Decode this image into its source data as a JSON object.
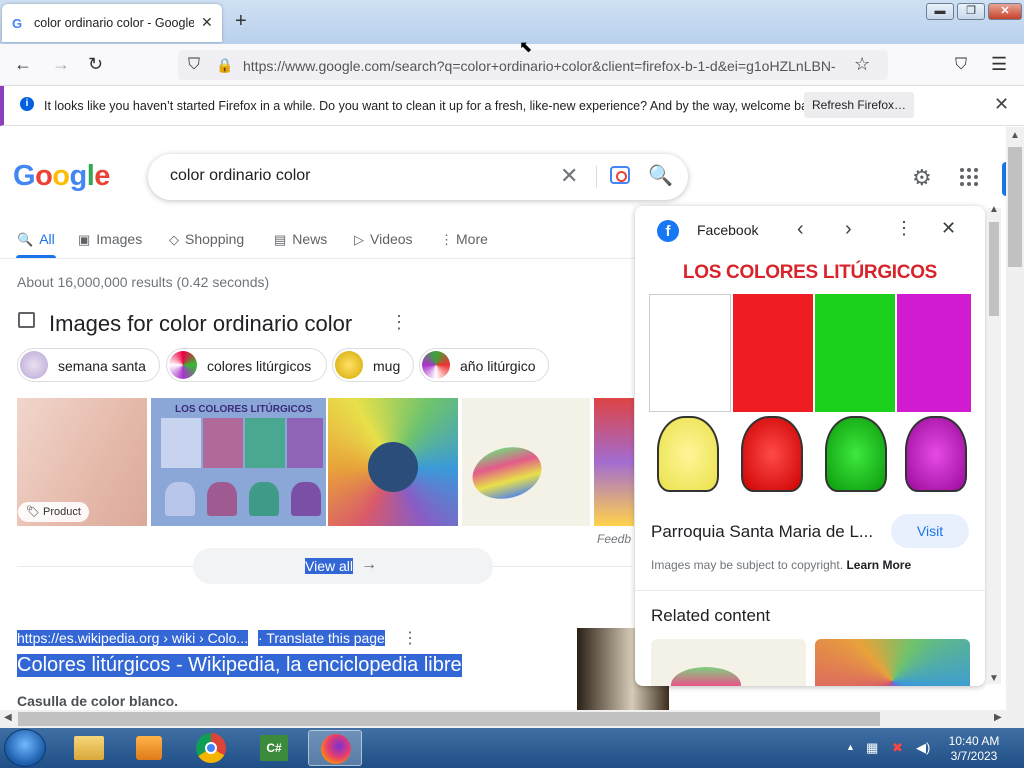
{
  "browser": {
    "tab_title": "color ordinario color - Google S",
    "tab_favicon": "G",
    "close_tab": "✕",
    "new_tab": "+",
    "url": "https://www.google.com/search?q=color+ordinario+color&client=firefox-b-1-d&ei=g1oHZLnLBN-",
    "window_controls": {
      "minimize": "▬",
      "maximize": "❐",
      "close": "✕"
    },
    "nav": {
      "back": "←",
      "forward": "→",
      "reload": "↻",
      "shield": "⛉",
      "lock": "🔒",
      "star": "☆",
      "pocket": "⛉",
      "menu": "☰"
    }
  },
  "notification": {
    "icon": "i",
    "message": "It looks like you haven’t started Firefox in a while. Do you want to clean it up for a fresh, like-new experience? And by the way, welcome back!",
    "button": "Refresh Firefox…",
    "close": "✕"
  },
  "google": {
    "logo_letters": [
      {
        "ch": "G",
        "color": "#4285f4"
      },
      {
        "ch": "o",
        "color": "#ea4335"
      },
      {
        "ch": "o",
        "color": "#fbbc05"
      },
      {
        "ch": "g",
        "color": "#4285f4"
      },
      {
        "ch": "l",
        "color": "#34a853"
      },
      {
        "ch": "e",
        "color": "#ea4335"
      }
    ],
    "query": "color ordinario color",
    "clear_icon": "✕",
    "search_icon": "🔍",
    "settings_icon": "⚙",
    "tabs": [
      {
        "label": "All",
        "icon": "🔍"
      },
      {
        "label": "Images",
        "icon": "▣"
      },
      {
        "label": "Shopping",
        "icon": "◇"
      },
      {
        "label": "News",
        "icon": "▤"
      },
      {
        "label": "Videos",
        "icon": "▷"
      },
      {
        "label": "More",
        "icon": "⋮"
      }
    ],
    "stats": "About 16,000,000 results (0.42 seconds)",
    "images_heading": "Images for color ordinario color",
    "more_dots": "⋮",
    "chips": [
      "semana santa",
      "colores litúrgicos",
      "mug",
      "año litúrgico"
    ],
    "product_badge": "Product",
    "feedback": "Feedb",
    "view_all": "View all",
    "arrow": "→",
    "result": {
      "url": "https://es.wikipedia.org › wiki › Colo...",
      "translate": "· Translate this page",
      "title": "Colores litúrgicos - Wikipedia, la enciclopedia libre",
      "snippet": "Casulla de color blanco."
    }
  },
  "panel": {
    "source": "Facebook",
    "fb_letter": "f",
    "prev": "‹",
    "next": "›",
    "more": "⋮",
    "close": "✕",
    "image_title": "LOS COLORES LITÚRGICOS",
    "title": "Parroquia Santa Maria de L...",
    "visit": "Visit",
    "copyright": "Images may be subject to copyright.",
    "learn_more": "Learn More",
    "related": "Related content",
    "liturgical_colors": [
      "#ffffff",
      "#ff0000",
      "#00cc00",
      "#cc00cc"
    ]
  },
  "taskbar": {
    "time": "10:40 AM",
    "date": "3/7/2023",
    "tray_up": "▲"
  },
  "scroll": {
    "up": "▲",
    "down": "▼",
    "left": "◀",
    "right": "▶"
  }
}
